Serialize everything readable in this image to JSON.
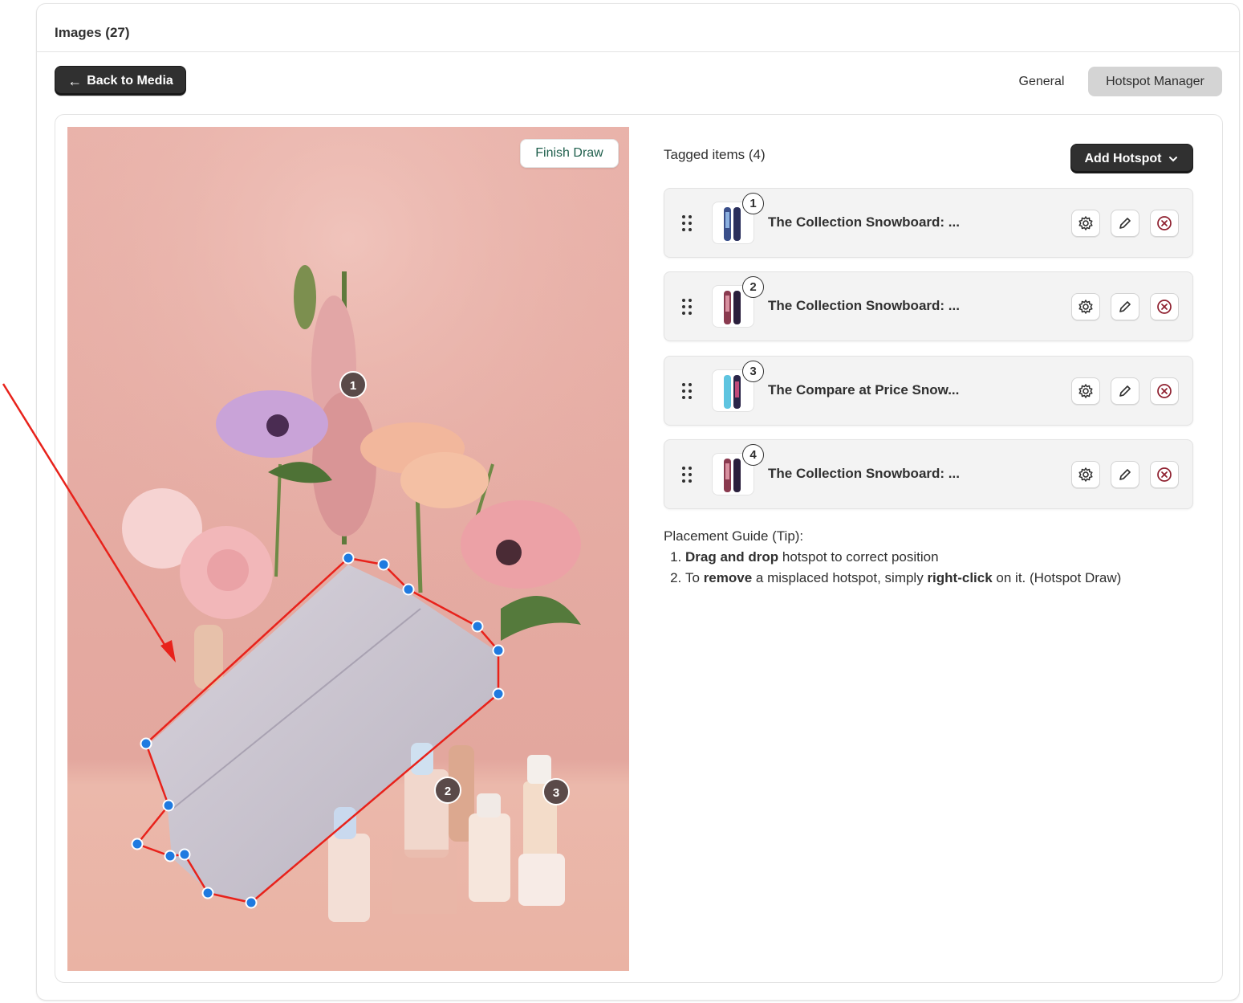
{
  "header": {
    "title": "Images (27)"
  },
  "toolbar": {
    "back_label": "Back to Media"
  },
  "tabs": [
    {
      "label": "General",
      "active": false
    },
    {
      "label": "Hotspot Manager",
      "active": true
    }
  ],
  "canvas": {
    "finish_label": "Finish Draw",
    "hotspot_markers": [
      "1",
      "2",
      "3"
    ]
  },
  "panel": {
    "title": "Tagged items (4)",
    "add_label": "Add Hotspot",
    "items": [
      {
        "number": "1",
        "name": "The Collection Snowboard: ..."
      },
      {
        "number": "2",
        "name": "The Collection Snowboard: ..."
      },
      {
        "number": "3",
        "name": "The Compare at Price Snow..."
      },
      {
        "number": "4",
        "name": "The Collection Snowboard: ..."
      }
    ]
  },
  "guide": {
    "title": "Placement Guide (Tip):",
    "step1": {
      "bold": "Drag and drop",
      "rest": " hotspot to correct position"
    },
    "step2": {
      "pre": "To ",
      "bold1": "remove",
      "mid": " a misplaced hotspot, simply ",
      "bold2": "right-click",
      "post": " on it. (Hotspot Draw)"
    }
  },
  "colors": {
    "primary_button": "#303030",
    "polygon_stroke": "#e8221b",
    "vertex": "#1f7ae0",
    "delete_icon": "#8e1f2e",
    "finish_text": "#1f5f4c"
  }
}
